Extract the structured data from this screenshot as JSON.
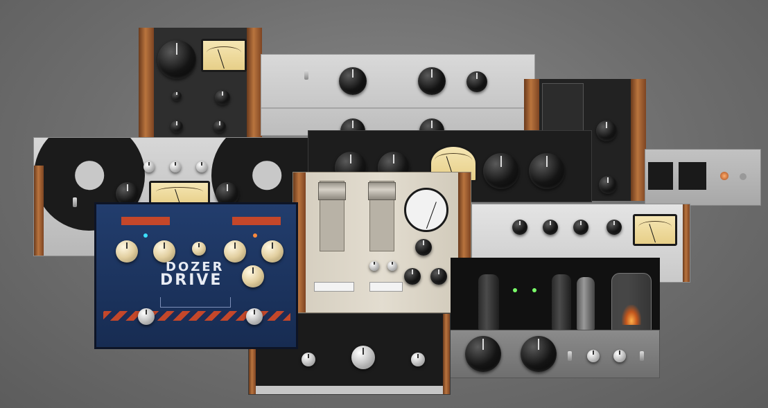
{
  "scene": {
    "description_free": true
  },
  "dozer_panel": {
    "brand": "DOZER",
    "product": "DRIVE"
  },
  "colors": {
    "background": "#6e6e6e",
    "dozer_blue": "#1c3561",
    "dozer_orange": "#c4472a",
    "meter_face": "#f0dfa6",
    "wood": "#a5652f",
    "tube_glow": "#ff9a3c"
  },
  "icons": {
    "reel": "tape-reel-icon",
    "meter": "vu-meter-icon",
    "tube": "vacuum-tube-icon"
  }
}
